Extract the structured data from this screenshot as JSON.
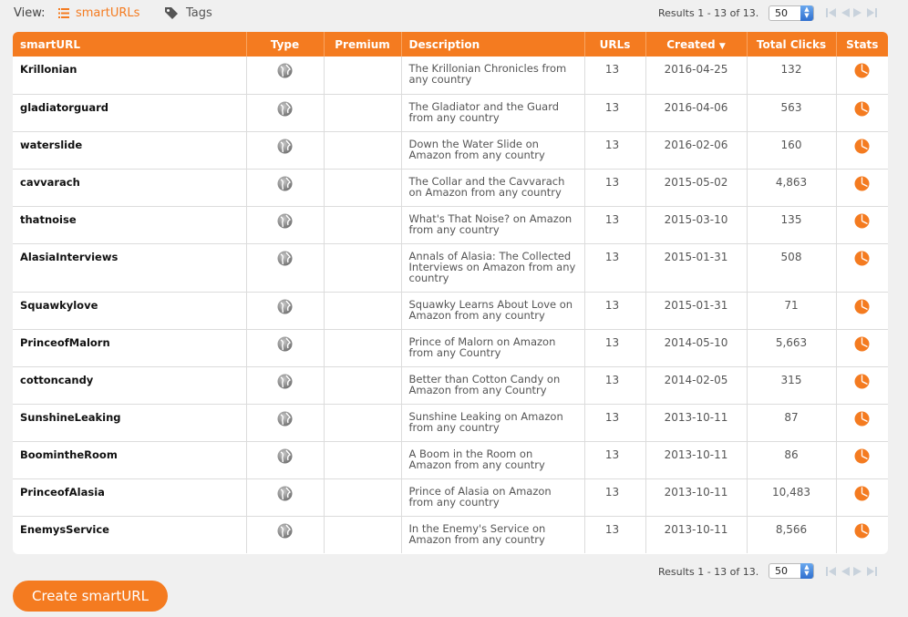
{
  "view": {
    "label": "View:",
    "smarturls_label": "smartURLs",
    "tags_label": "Tags"
  },
  "pagination": {
    "results_text": "Results 1 - 13 of 13.",
    "per_page": "50"
  },
  "colors": {
    "accent": "#f47b20",
    "spin": "#3b7ad8"
  },
  "table": {
    "headers": {
      "smarturl": "smartURL",
      "type": "Type",
      "premium": "Premium",
      "description": "Description",
      "urls": "URLs",
      "created": "Created",
      "total_clicks": "Total Clicks",
      "stats": "Stats"
    },
    "rows": [
      {
        "name": "Krillonian",
        "description": "The Krillonian Chronicles from any country",
        "urls": "13",
        "created": "2016-04-25",
        "clicks": "132"
      },
      {
        "name": "gladiatorguard",
        "description": "The Gladiator and the Guard from any country",
        "urls": "13",
        "created": "2016-04-06",
        "clicks": "563"
      },
      {
        "name": "waterslide",
        "description": "Down the Water Slide on Amazon from any country",
        "urls": "13",
        "created": "2016-02-06",
        "clicks": "160"
      },
      {
        "name": "cavvarach",
        "description": "The Collar and the Cavvarach on Amazon from any country",
        "urls": "13",
        "created": "2015-05-02",
        "clicks": "4,863"
      },
      {
        "name": "thatnoise",
        "description": "What's That Noise? on Amazon from any country",
        "urls": "13",
        "created": "2015-03-10",
        "clicks": "135"
      },
      {
        "name": "AlasiaInterviews",
        "description": "Annals of Alasia: The Collected Interviews on Amazon from any country",
        "urls": "13",
        "created": "2015-01-31",
        "clicks": "508"
      },
      {
        "name": "Squawkylove",
        "description": "Squawky Learns About Love on Amazon from any country",
        "urls": "13",
        "created": "2015-01-31",
        "clicks": "71"
      },
      {
        "name": "PrinceofMalorn",
        "description": "Prince of Malorn on Amazon from any Country",
        "urls": "13",
        "created": "2014-05-10",
        "clicks": "5,663"
      },
      {
        "name": "cottoncandy",
        "description": "Better than Cotton Candy on Amazon from any Country",
        "urls": "13",
        "created": "2014-02-05",
        "clicks": "315"
      },
      {
        "name": "SunshineLeaking",
        "description": "Sunshine Leaking on Amazon from any country",
        "urls": "13",
        "created": "2013-10-11",
        "clicks": "87"
      },
      {
        "name": "BoomintheRoom",
        "description": "A Boom in the Room on Amazon from any country",
        "urls": "13",
        "created": "2013-10-11",
        "clicks": "86"
      },
      {
        "name": "PrinceofAlasia",
        "description": "Prince of Alasia on Amazon from any country",
        "urls": "13",
        "created": "2013-10-11",
        "clicks": "10,483"
      },
      {
        "name": "EnemysService",
        "description": "In the Enemy's Service on Amazon from any country",
        "urls": "13",
        "created": "2013-10-11",
        "clicks": "8,566"
      }
    ]
  },
  "icons": {
    "type": "globe-icon",
    "stats": "pie-chart-icon",
    "view_list": "list-icon",
    "view_tags": "tag-icon"
  },
  "create_button": "Create smartURL"
}
